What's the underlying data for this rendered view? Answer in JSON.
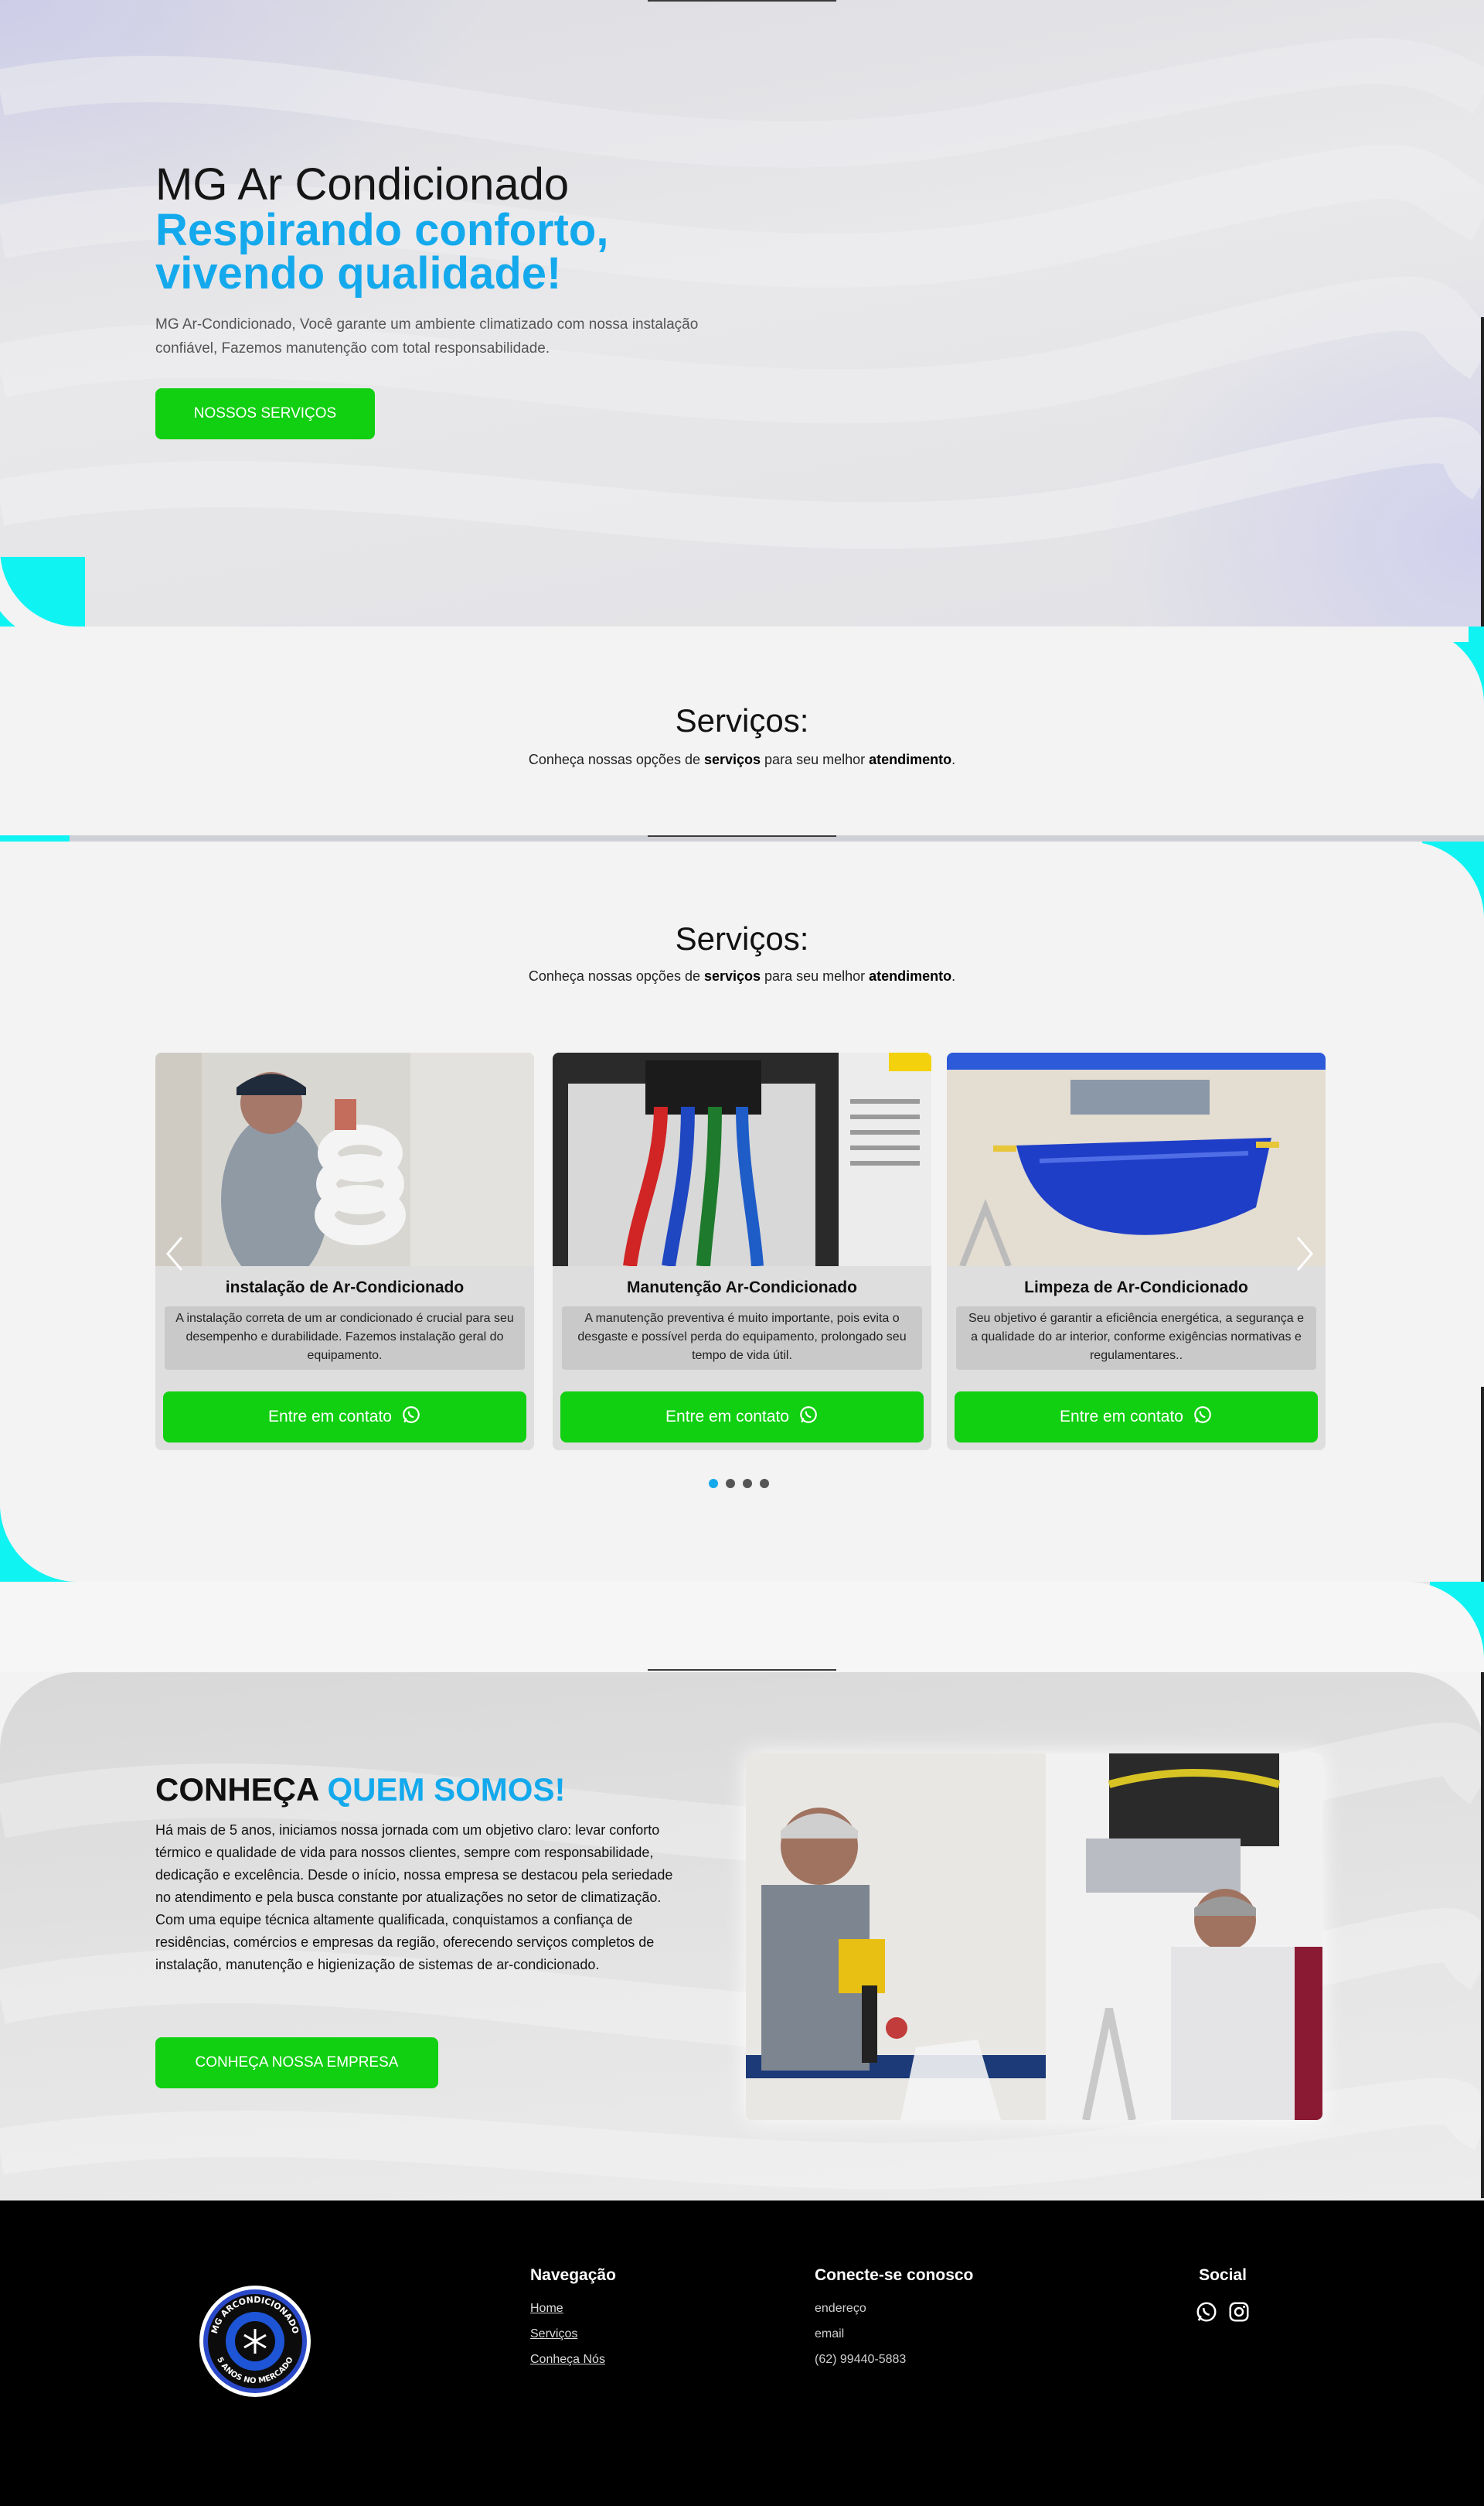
{
  "hero": {
    "brand": "MG Ar Condicionado",
    "slogan_line1": "Respirando conforto,",
    "slogan_line2": "vivendo qualidade!",
    "description": "MG Ar-Condicionado, Você garante um ambiente climatizado com nossa instalação confiável, Fazemos manutenção com total responsabilidade.",
    "button_label": "NOSSOS SERVIÇOS"
  },
  "services": {
    "title": "Serviços:",
    "subtitle_pre": "Conheça nossas opções de ",
    "subtitle_b1": "serviços",
    "subtitle_mid": " para seu melhor ",
    "subtitle_b2": "atendimento",
    "subtitle_end": ".",
    "cards": [
      {
        "title": "instalação de Ar-Condicionado",
        "description": "A instalação correta de um ar condicionado é crucial para seu desempenho e durabilidade. Fazemos instalação geral do equipamento.",
        "button_label": "Entre em contato"
      },
      {
        "title": "Manutenção Ar-Condicionado",
        "description": "A manutenção preventiva é muito importante, pois evita o desgaste e possível perda do equipamento, prolongado seu tempo de vida útil.",
        "button_label": "Entre em contato"
      },
      {
        "title": "Limpeza de Ar-Condicionado",
        "description": "Seu objetivo é garantir a eficiência energética, a segurança e a qualidade do ar interior, conforme exigências normativas e regulamentares..",
        "button_label": "Entre em contato"
      }
    ],
    "icons": {
      "prev": "chevron-left-icon",
      "next": "chevron-right-icon",
      "contact": "whatsapp-icon"
    }
  },
  "about": {
    "title_pre": "CONHEÇA ",
    "title_highlight": "QUEM SOMOS!",
    "text": "Há mais de 5 anos, iniciamos nossa jornada com um objetivo claro: levar conforto térmico e qualidade de vida para nossos clientes, sempre com responsabilidade, dedicação e excelência. Desde o início, nossa empresa se destacou pela seriedade no atendimento e pela busca constante por atualizações no setor de climatização. Com uma equipe técnica altamente qualificada, conquistamos a confiança de residências, comércios e empresas da região, oferecendo serviços completos de instalação, manutenção e higienização de sistemas de ar-condicionado.",
    "button_label": "CONHEÇA NOSSA EMPRESA"
  },
  "footer": {
    "logo_text_top": "MG ARCONDICIONADO",
    "logo_text_bottom": "5 ANOS NO MERCADO",
    "nav_title": "Navegação",
    "nav_links": [
      "Home",
      "Serviços",
      "Conheça Nós"
    ],
    "contact_title": "Conecte-se conosco",
    "contact_items": [
      "endereço",
      "email",
      "(62) 99440-5883"
    ],
    "social_title": "Social",
    "social_icons": [
      "whatsapp-icon",
      "instagram-icon"
    ]
  },
  "colors": {
    "accent_blue": "#14a9ec",
    "button_green": "#11cf11",
    "cyan_shape": "#10f3f3"
  }
}
